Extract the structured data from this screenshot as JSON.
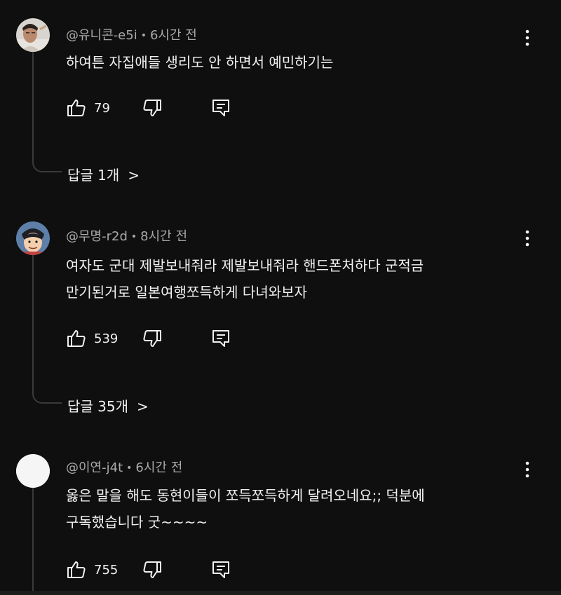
{
  "comments": [
    {
      "handle": "@유니콘-e5i",
      "time": "6시간 전",
      "text_lines": [
        "하여튼 자집애들 생리도 안 하면서 예민하기는"
      ],
      "likes": "79",
      "replies_label": "답글 1개",
      "avatar": "photo-avatar"
    },
    {
      "handle": "@무명-r2d",
      "time": "8시간 전",
      "text_lines": [
        "여자도 군대 제발보내줘라 제발보내줘라 핸드폰처하다 군적금",
        "만기된거로 일본여행쪼득하게 다녀와보자"
      ],
      "likes": "539",
      "replies_label": "답글 35개",
      "avatar": "cartoon-avatar"
    },
    {
      "handle": "@이연-j4t",
      "time": "6시간 전",
      "text_lines": [
        "옳은 말을 해도 동현이들이 쪼득쪼득하게 달려오네요;; 덕분에",
        "구독했습니다 굿~~~~"
      ],
      "likes": "755",
      "replies_label": "",
      "avatar": "blank-avatar"
    }
  ],
  "separator": "•",
  "chevron": ">",
  "colors": {
    "background": "#0f0f0f",
    "text": "#f1f1f1",
    "meta": "#aaaaaa",
    "thread": "#3a3a3a"
  }
}
